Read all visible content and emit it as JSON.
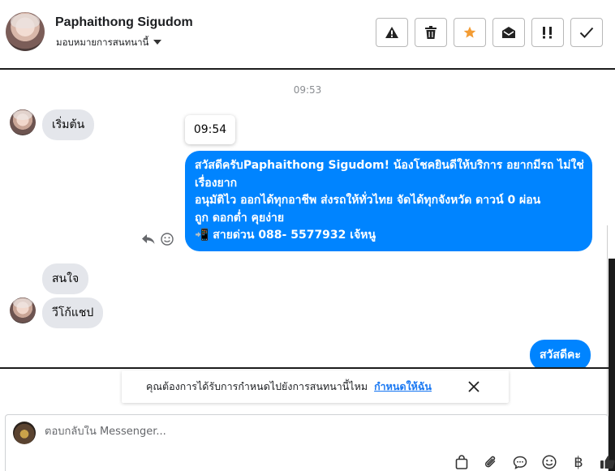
{
  "header": {
    "contact_name": "Paphaithong Sigudom",
    "assign_label": "มอบหมายการสนทนานี้",
    "actions": [
      "alert-icon",
      "trash-icon",
      "star-icon",
      "mark-unread-icon",
      "important-icon",
      "check-icon"
    ]
  },
  "colors": {
    "outgoing_bubble": "#0084ff",
    "incoming_bubble": "#e4e6eb",
    "star": "#f39c34",
    "link": "#1877f2"
  },
  "thread": {
    "time_separator": "09:53",
    "tooltip_time": "09:54",
    "messages": [
      {
        "direction": "in",
        "text": "เริ่มต้น"
      },
      {
        "direction": "out",
        "lines": [
          "สวัสดีครับPaphaithong Sigudom! น้องโชคยินดีให้บริการ อยากมีรถ ไม่ใช่",
          "เรื่องยาก",
          "อนุมัติไว ออกได้ทุกอาชีพ ส่งรถให้ทั่วไทย จัดได้ทุกจังหวัด ดาวน์ 0  ผ่อน",
          "ถูก ดอกต่ำ คุยง่าย",
          "📲 สายด่วน 088- 5577932 เจ้หนู"
        ]
      },
      {
        "direction": "in",
        "text": "สนใจ"
      },
      {
        "direction": "in",
        "text": "วีโก้แชป"
      },
      {
        "direction": "out",
        "text": "สวัสดีคะ"
      }
    ]
  },
  "suggestion": {
    "text": "คุณต้องการได้รับการกำหนดไปยังการสนทนานี้ไหม",
    "link": "กำหนดให้ฉัน"
  },
  "composer": {
    "placeholder": "ตอบกลับใน Messenger...",
    "baht_symbol": "฿",
    "tools": [
      "shopping-bag-icon",
      "attachment-icon",
      "saved-reply-icon",
      "emoji-icon",
      "baht-icon",
      "thumbs-up-icon"
    ]
  }
}
